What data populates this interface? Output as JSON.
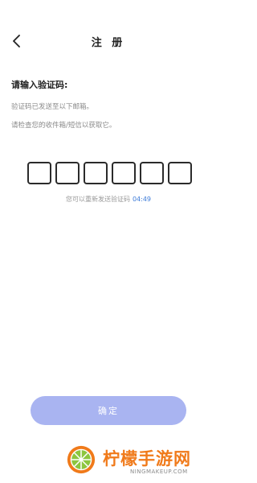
{
  "header": {
    "title": "注 册",
    "back_icon": "chevron-left-icon"
  },
  "verify": {
    "prompt": "请输入验证码:",
    "sent_notice": "验证码已发送至以下邮箱。",
    "check_notice": "请检查您的收件箱/短信以获取它。",
    "code_length": 6,
    "resend_text": "您可以重新发送验证码",
    "countdown": "04:49"
  },
  "actions": {
    "confirm_label": "确定"
  },
  "watermark": {
    "brand": "柠檬手游网",
    "url": "NINGMAKEUP.COM"
  },
  "colors": {
    "accent_blue": "#3d7bd8",
    "button_bg": "#a9b4f1",
    "watermark_orange": "#f07a1a"
  }
}
